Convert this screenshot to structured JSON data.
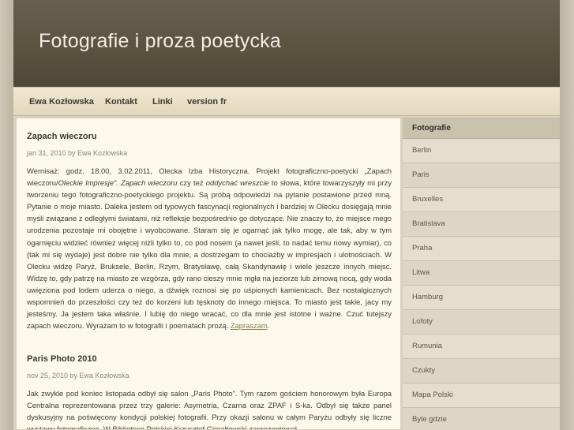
{
  "site": {
    "title": "Fotografie i proza poetycka"
  },
  "nav": {
    "items": [
      {
        "label": "Ewa Kozłowska"
      },
      {
        "label": "Kontakt"
      },
      {
        "label": "Linki"
      },
      {
        "label": "version fr"
      }
    ]
  },
  "posts": [
    {
      "title": "Zapach wieczoru",
      "meta": "jan 31, 2010 by Ewa Kozłowska",
      "body_part1": "Wernisaż: godz. 18.00, 3.02.2011, Olecka Izba Historyczna. Projekt fotograficzno-poetycki „Zapach wieczoru/",
      "body_em1": "Oleckie Impresje”. Zapach wieczoru",
      "body_part2": " czy też ",
      "body_em2": "oddychać wreszcie",
      "body_part3": " to słowa, które towarzyszyły mi przy tworzeniu tego fotograficzno-poetyckiego projektu. Są próbą odpowiedzi na pytanie postawione przed mną. Pytanie o moje miasto. Daleka jestem od typowych fascynacji regionalnych i bardziej w Olecku dosięgają mnie myśli związane z odległymi światami, niż refleksje bezpośrednio go dotyczące. Nie znaczy to, że miejsce mego urodzenia pozostaje mi obojętne i wyobcowane. Staram się je ogarnąć jak tylko mogę, ale tak, aby w tym ogarnięciu widzieć również więcej niżli tylko to, co pod nosem (a nawet jeśli, to nadać temu nowy wymiar), co (tak mi się wydaje) jest dobre nie tylko dla mnie, a dostrzegam to chociażby w impresjach i ulotnościach. W Olecku widzę Paryż, Bruksele, Berlin, Rzym, Bratysławę, całą Skandynawię i wiele jeszcze innych miejsc. Widzę to, gdy patrzę na miasto ze wzgórza, gdy rano cieszy mnie mgła na jeziorze lub zimową nocą, gdy woda uwięziona pod lodem uderza o niego, a dźwięk roznosi się po uśpionych kamienicach. Bez nostalgicznych wspomnień do przeszłości czy też do korzeni lub tęsknoty do innego miejsca. To miasto jest takie, jacy my jesteśmy. Ja jestem taka właśnie. I lubię do niego wracać, co dla mnie jest istotne i ważne. Czuć tutejszy zapach wieczoru. Wyrażam to w fotografii i poematach prozą. ",
      "link": "Zapraszam",
      "body_end": "."
    },
    {
      "title": "Paris Photo 2010",
      "meta": "nov 25, 2010 by Ewa Kozłowska",
      "body": "Jak zwykle pod koniec listopada odbył się salon „Paris Photo”. Tym razem gościem honorowym była Europa Centralna reprezentowana przez trzy galerie: Asymetria, Czarna oraz ZPAF i S-ka. Odbył się także panel dyskusyjny na poświęcony kondycji polskiej fotografii. Przy okazji salonu w całym Paryżu odbyły się liczne wystawy fotograficzne. W Bibliotece Polskiej Krzysztof Gierałtowski zaprezentował"
    }
  ],
  "sidebar": {
    "header": "Fotografie",
    "items": [
      {
        "label": "Berlin"
      },
      {
        "label": "Paris"
      },
      {
        "label": "Bruxelles"
      },
      {
        "label": "Bratislava"
      },
      {
        "label": "Praha"
      },
      {
        "label": "Litwa"
      },
      {
        "label": "Hamburg"
      },
      {
        "label": "Lofoty"
      },
      {
        "label": "Rumunia"
      },
      {
        "label": "Czukty"
      },
      {
        "label": "Mapa Polski"
      },
      {
        "label": "Byle gdzie"
      }
    ]
  }
}
